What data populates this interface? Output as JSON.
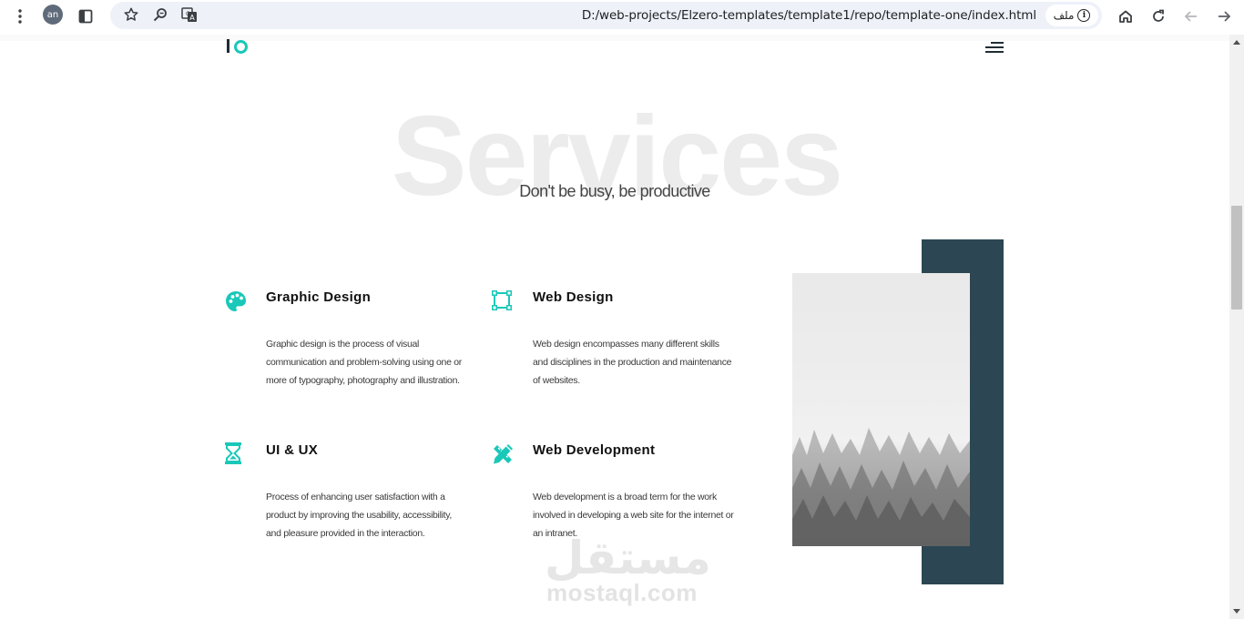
{
  "browser": {
    "url": "D:/web-projects/Elzero-templates/template1/repo/template-one/index.html",
    "site_label": "ملف",
    "profile_initials": "an",
    "icons": [
      "kebab-menu-icon",
      "profile-avatar",
      "sidebar-toggle-icon",
      "bookmark-star-icon",
      "zoom-icon",
      "translate-icon",
      "site-info-icon",
      "home-icon",
      "reload-icon",
      "back-icon",
      "forward-icon"
    ]
  },
  "header": {
    "logo_mark": "logo-icon",
    "menu_icon": "hamburger-menu-icon"
  },
  "section": {
    "background_title": "Services",
    "subtitle": "Don't be busy, be productive"
  },
  "services": [
    {
      "icon": "palette-icon",
      "title": "Graphic Design",
      "text": "Graphic design is the process of visual communication and problem-solving using one or more of typography, photography and illustration."
    },
    {
      "icon": "vector-square-icon",
      "title": "Web Design",
      "text": "Web design encompasses many different skills and disciplines in the production and maintenance of websites."
    },
    {
      "icon": "hourglass-icon",
      "title": "UI & UX",
      "text": "Process of enhancing user satisfaction with a product by improving the usability, accessibility, and pleasure provided in the interaction."
    },
    {
      "icon": "pencil-ruler-icon",
      "title": "Web Development",
      "text": "Web development is a broad term for the work involved in developing a web site for the internet or an intranet."
    }
  ],
  "watermark": {
    "arabic": "مستقل",
    "latin": "mostaql.com"
  },
  "colors": {
    "accent": "#19c8b9",
    "dark_block": "#2c4653",
    "title_ghost": "#ececec",
    "heading": "#111111"
  }
}
